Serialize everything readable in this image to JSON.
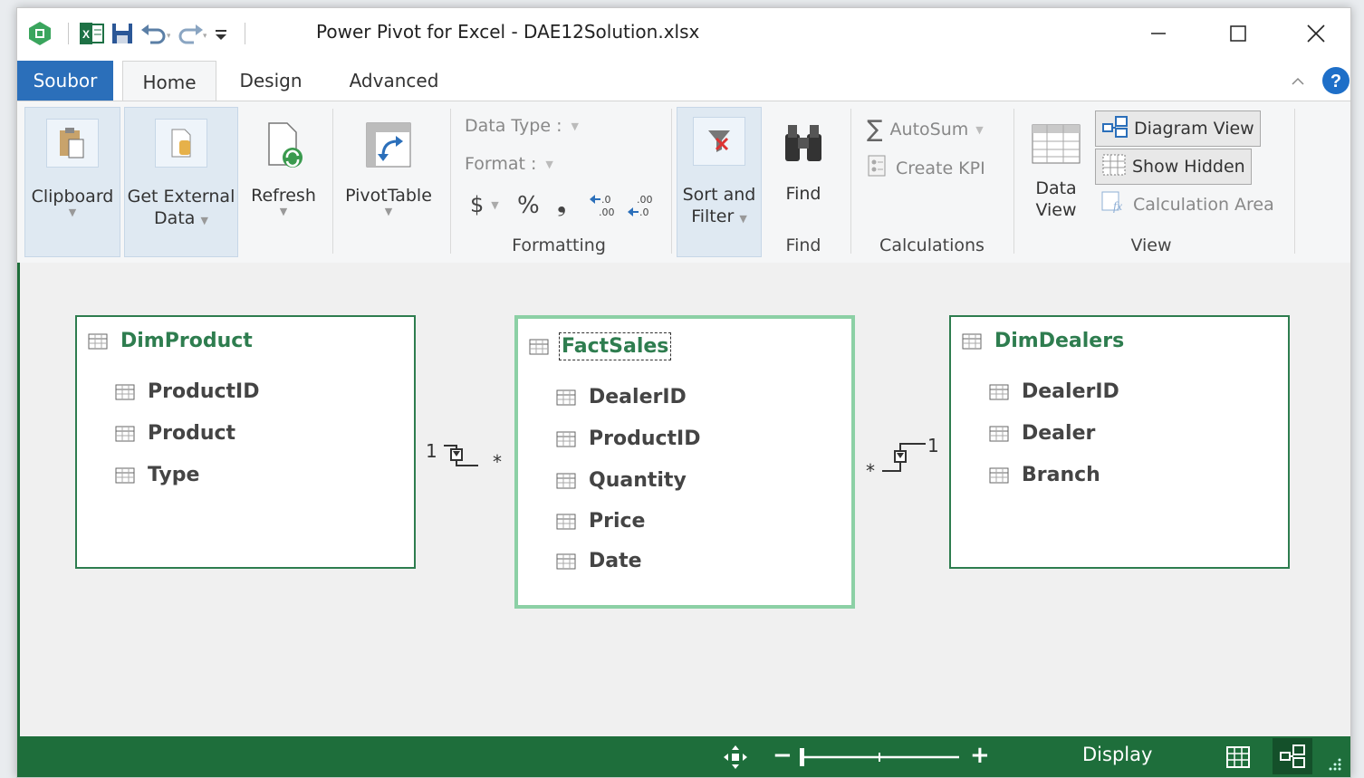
{
  "window": {
    "title": "Power Pivot for Excel - DAE12Solution.xlsx",
    "minimize": "—",
    "maximize": "☐",
    "close": "✕"
  },
  "tabs": {
    "file": "Soubor",
    "home": "Home",
    "design": "Design",
    "advanced": "Advanced"
  },
  "ribbon": {
    "clipboard": "Clipboard",
    "get_external_data_1": "Get External",
    "get_external_data_2": "Data",
    "refresh": "Refresh",
    "pivottable": "PivotTable",
    "data_type": "Data Type :",
    "format": "Format :",
    "currency": "$",
    "percent": "%",
    "comma": "❟",
    "formatting_group": "Formatting",
    "sort_filter_1": "Sort and",
    "sort_filter_2": "Filter",
    "find": "Find",
    "find_group": "Find",
    "autosum": "AutoSum",
    "create_kpi": "Create KPI",
    "calculations_group": "Calculations",
    "data_view_1": "Data",
    "data_view_2": "View",
    "diagram_view": "Diagram View",
    "show_hidden": "Show Hidden",
    "calculation_area": "Calculation Area",
    "view_group": "View"
  },
  "diagram": {
    "tables": [
      {
        "name": "DimProduct",
        "columns": [
          "ProductID",
          "Product",
          "Type"
        ]
      },
      {
        "name": "FactSales",
        "columns": [
          "DealerID",
          "ProductID",
          "Quantity",
          "Price",
          "Date"
        ]
      },
      {
        "name": "DimDealers",
        "columns": [
          "DealerID",
          "Dealer",
          "Branch"
        ]
      }
    ],
    "relationships": [
      {
        "one": "1",
        "many": "*"
      },
      {
        "one": "1",
        "many": "*"
      }
    ]
  },
  "statusbar": {
    "display": "Display",
    "zoom_minus": "−",
    "zoom_plus": "+"
  },
  "colors": {
    "accent_green": "#1e6e3b",
    "file_tab_blue": "#2b6fba",
    "table_title_green": "#2e7d4f"
  }
}
